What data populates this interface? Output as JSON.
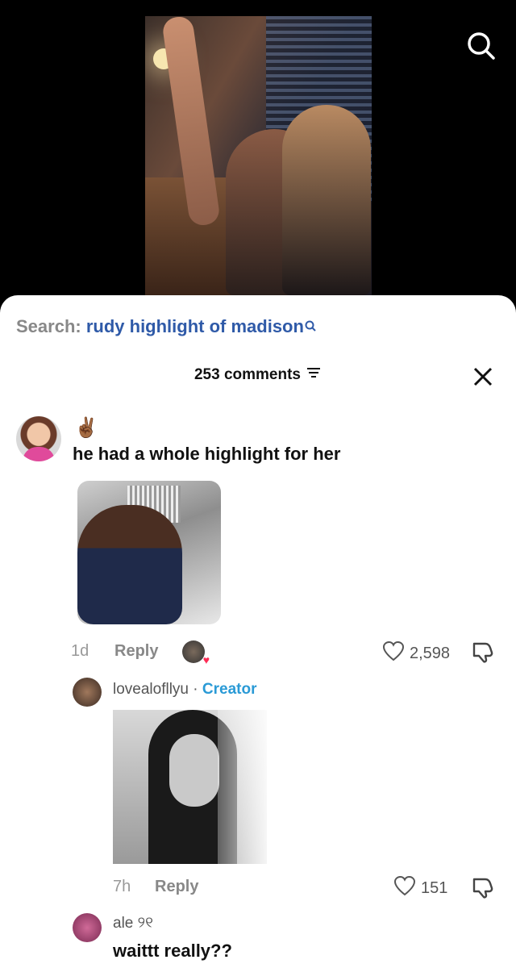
{
  "search": {
    "prefix": "Search:",
    "query": "rudy highlight of madison"
  },
  "header": {
    "comments_count": "253 comments"
  },
  "comments": [
    {
      "emoji": "✌🏾",
      "text": "he had a whole highlight for her",
      "time": "1d",
      "reply_label": "Reply",
      "likes": "2,598"
    },
    {
      "username": "lovealofllyu",
      "separator": " · ",
      "badge": "Creator",
      "time": "7h",
      "reply_label": "Reply",
      "likes": "151"
    },
    {
      "username": "ale ୨୧",
      "text": "waittt really??"
    }
  ],
  "colors": {
    "accent": "#2f5aa8",
    "creator": "#2a9ad6",
    "heart": "#fe2c55"
  },
  "icons": [
    "search-icon",
    "close-icon",
    "filter-icon",
    "heart-outline-icon",
    "dislike-icon"
  ]
}
